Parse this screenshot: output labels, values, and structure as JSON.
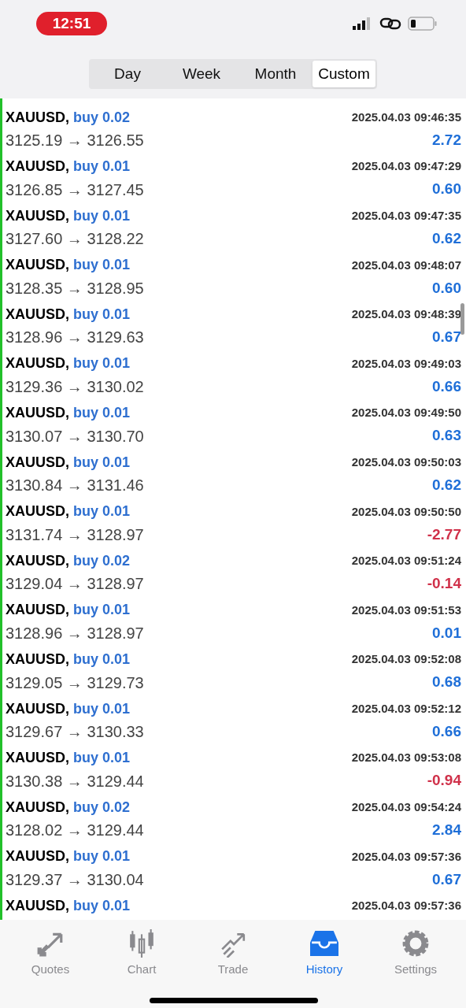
{
  "status_bar": {
    "time": "12:51"
  },
  "period_tabs": [
    {
      "label": "Day",
      "selected": false
    },
    {
      "label": "Week",
      "selected": false
    },
    {
      "label": "Month",
      "selected": false
    },
    {
      "label": "Custom",
      "selected": true
    }
  ],
  "deals": [
    {
      "symbol": "XAUUSD,",
      "side": "buy 0.02",
      "time": "2025.04.03 09:46:35",
      "prices": "3125.19 → 3126.55",
      "profit": "2.72",
      "color": "#1f6fd8"
    },
    {
      "symbol": "XAUUSD,",
      "side": "buy 0.01",
      "time": "2025.04.03 09:47:29",
      "prices": "3126.85 → 3127.45",
      "profit": "0.60",
      "color": "#1f6fd8"
    },
    {
      "symbol": "XAUUSD,",
      "side": "buy 0.01",
      "time": "2025.04.03 09:47:35",
      "prices": "3127.60 → 3128.22",
      "profit": "0.62",
      "color": "#1f6fd8"
    },
    {
      "symbol": "XAUUSD,",
      "side": "buy 0.01",
      "time": "2025.04.03 09:48:07",
      "prices": "3128.35 → 3128.95",
      "profit": "0.60",
      "color": "#1f6fd8"
    },
    {
      "symbol": "XAUUSD,",
      "side": "buy 0.01",
      "time": "2025.04.03 09:48:39",
      "prices": "3128.96 → 3129.63",
      "profit": "0.67",
      "color": "#1f6fd8"
    },
    {
      "symbol": "XAUUSD,",
      "side": "buy 0.01",
      "time": "2025.04.03 09:49:03",
      "prices": "3129.36 → 3130.02",
      "profit": "0.66",
      "color": "#1f6fd8"
    },
    {
      "symbol": "XAUUSD,",
      "side": "buy 0.01",
      "time": "2025.04.03 09:49:50",
      "prices": "3130.07 → 3130.70",
      "profit": "0.63",
      "color": "#1f6fd8"
    },
    {
      "symbol": "XAUUSD,",
      "side": "buy 0.01",
      "time": "2025.04.03 09:50:03",
      "prices": "3130.84 → 3131.46",
      "profit": "0.62",
      "color": "#1f6fd8"
    },
    {
      "symbol": "XAUUSD,",
      "side": "buy 0.01",
      "time": "2025.04.03 09:50:50",
      "prices": "3131.74 → 3128.97",
      "profit": "-2.77",
      "color": "#d0314a"
    },
    {
      "symbol": "XAUUSD,",
      "side": "buy 0.02",
      "time": "2025.04.03 09:51:24",
      "prices": "3129.04 → 3128.97",
      "profit": "-0.14",
      "color": "#d0314a"
    },
    {
      "symbol": "XAUUSD,",
      "side": "buy 0.01",
      "time": "2025.04.03 09:51:53",
      "prices": "3128.96 → 3128.97",
      "profit": "0.01",
      "color": "#1f6fd8"
    },
    {
      "symbol": "XAUUSD,",
      "side": "buy 0.01",
      "time": "2025.04.03 09:52:08",
      "prices": "3129.05 → 3129.73",
      "profit": "0.68",
      "color": "#1f6fd8"
    },
    {
      "symbol": "XAUUSD,",
      "side": "buy 0.01",
      "time": "2025.04.03 09:52:12",
      "prices": "3129.67 → 3130.33",
      "profit": "0.66",
      "color": "#1f6fd8"
    },
    {
      "symbol": "XAUUSD,",
      "side": "buy 0.01",
      "time": "2025.04.03 09:53:08",
      "prices": "3130.38 → 3129.44",
      "profit": "-0.94",
      "color": "#d0314a"
    },
    {
      "symbol": "XAUUSD,",
      "side": "buy 0.02",
      "time": "2025.04.03 09:54:24",
      "prices": "3128.02 → 3129.44",
      "profit": "2.84",
      "color": "#1f6fd8"
    },
    {
      "symbol": "XAUUSD,",
      "side": "buy 0.01",
      "time": "2025.04.03 09:57:36",
      "prices": "3129.37 → 3130.04",
      "profit": "0.67",
      "color": "#1f6fd8"
    },
    {
      "symbol": "XAUUSD,",
      "side": "buy 0.01",
      "time": "2025.04.03 09:57:36"
    }
  ],
  "tab_bar": [
    {
      "label": "Quotes",
      "kind": "quotes",
      "selected": false
    },
    {
      "label": "Chart",
      "kind": "chart",
      "selected": false
    },
    {
      "label": "Trade",
      "kind": "trade",
      "selected": false
    },
    {
      "label": "History",
      "kind": "history",
      "selected": true
    },
    {
      "label": "Settings",
      "kind": "settings",
      "selected": false
    }
  ]
}
